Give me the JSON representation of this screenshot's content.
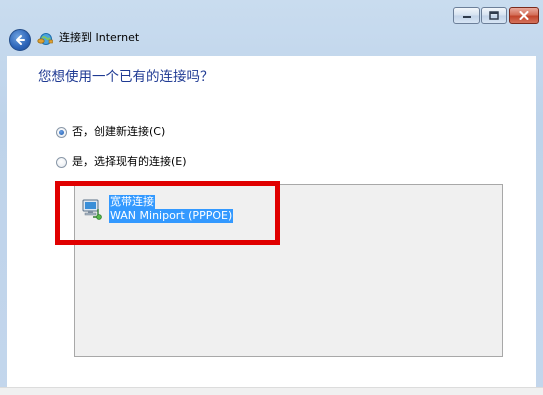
{
  "window": {
    "title": "连接到 Internet",
    "caption_buttons": {
      "minimize_icon": "minimize-icon",
      "maximize_icon": "maximize-icon",
      "close_icon": "close-icon"
    }
  },
  "header": {
    "back_icon": "back-arrow-icon",
    "wizard_icon": "network-globe-icon"
  },
  "main": {
    "question": "您想使用一个已有的连接吗？",
    "options": [
      {
        "label": "否，创建新连接(C)",
        "checked": true
      },
      {
        "label": "是，选择现有的连接(E)",
        "checked": false
      }
    ],
    "connections": [
      {
        "name": "宽带连接",
        "device": "WAN Miniport (PPPOE)",
        "icon": "network-connection-icon",
        "selected": true
      }
    ]
  },
  "colors": {
    "question_text": "#1f3a93",
    "selection": "#3399ff",
    "highlight_box": "#e00000",
    "list_background": "#f0f0f0"
  }
}
